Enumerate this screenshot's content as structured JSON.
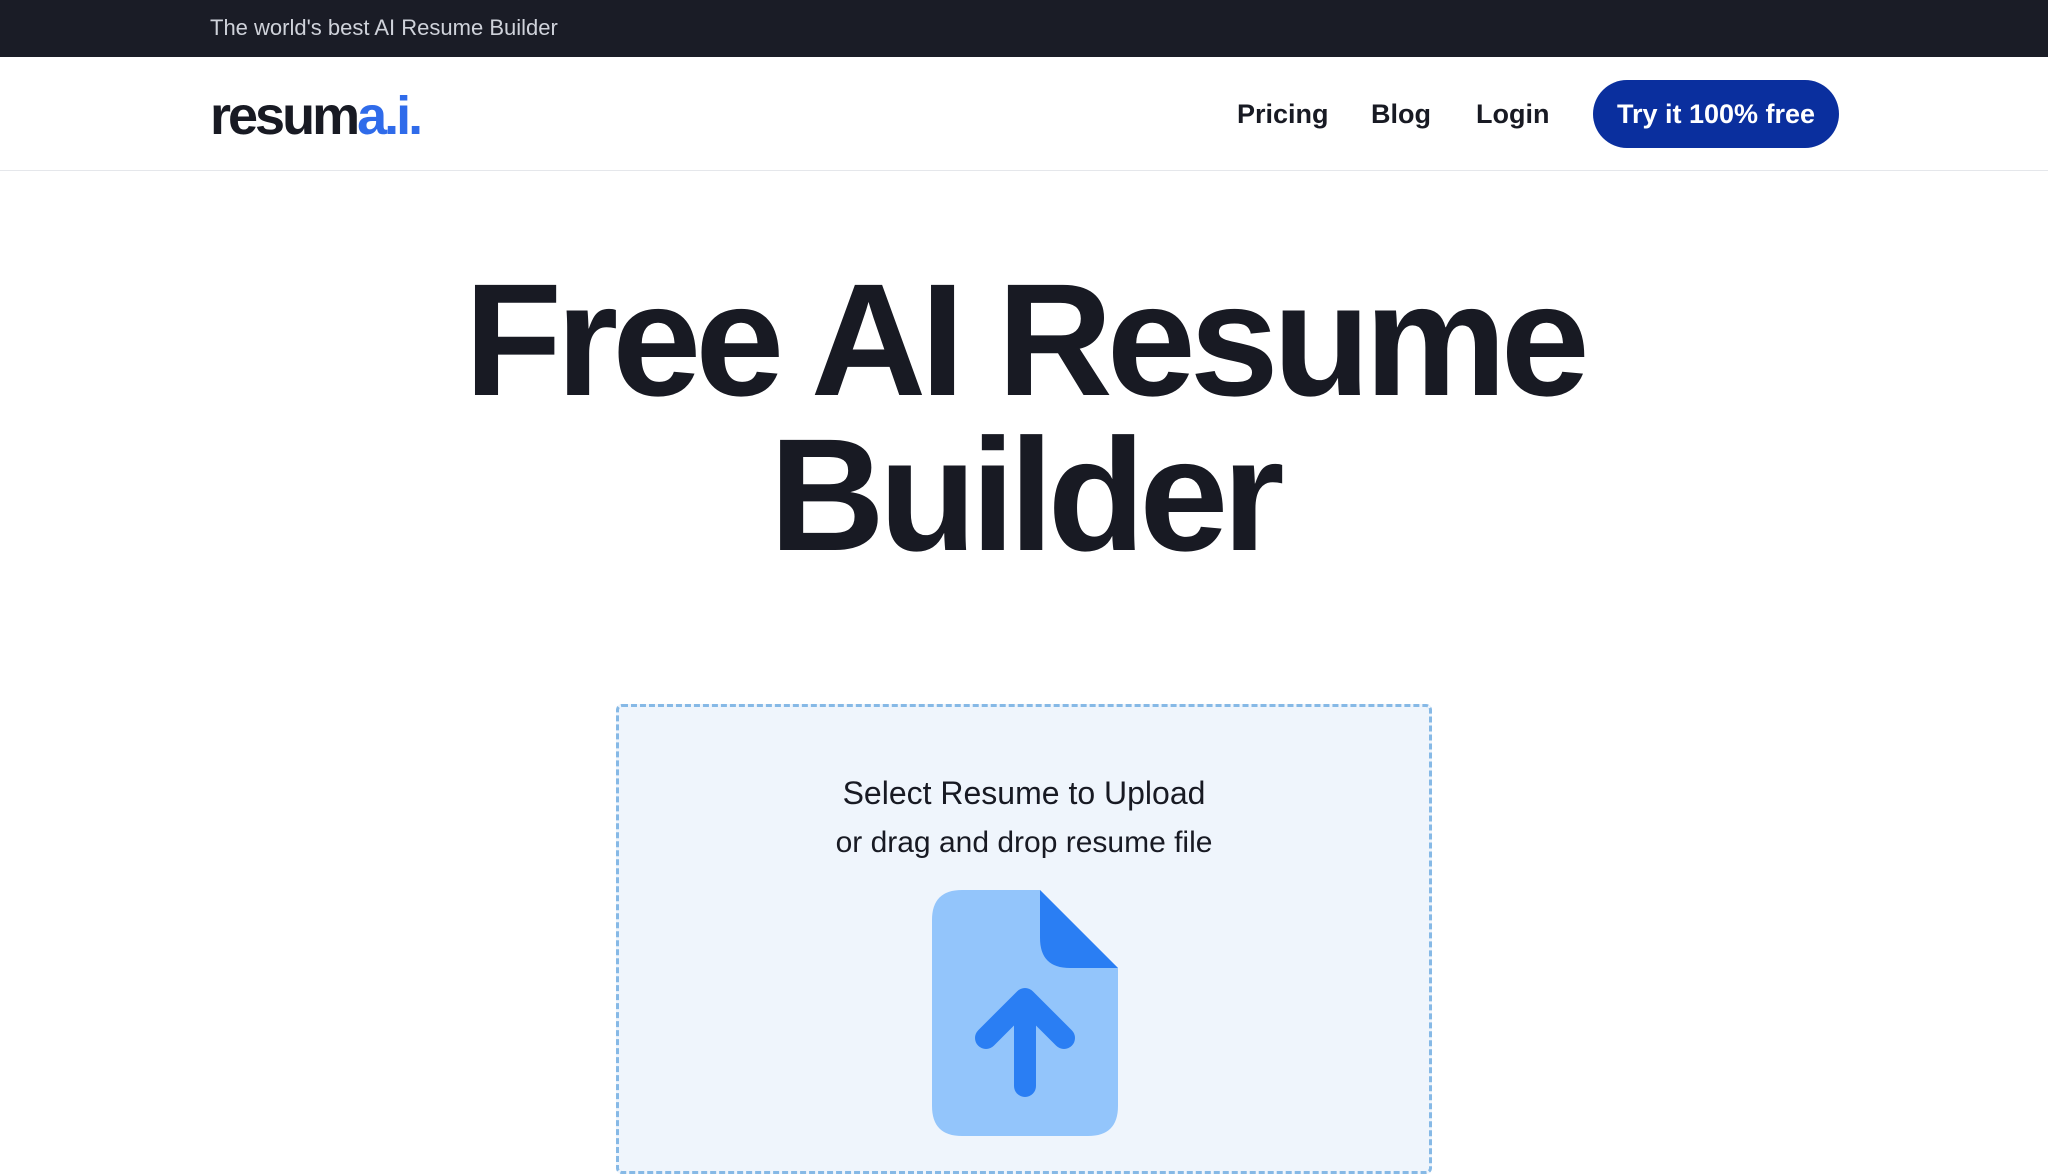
{
  "announcement": {
    "text": "The world's best AI Resume Builder"
  },
  "header": {
    "logo": {
      "main": "resum",
      "accent": "a.i."
    },
    "nav": {
      "pricing": "Pricing",
      "blog": "Blog",
      "login": "Login"
    },
    "cta_label": "Try it 100% free"
  },
  "hero": {
    "title_line1": "Free AI Resume",
    "title_line2": "Builder"
  },
  "upload": {
    "title": "Select Resume to Upload",
    "subtitle": "or drag and drop resume file",
    "icon": "file-upload-icon"
  },
  "colors": {
    "announcement_bg": "#1a1c26",
    "logo_accent": "#2f6bea",
    "cta_bg": "#0a2f9e",
    "dropzone_bg": "#eff5fc",
    "dropzone_border": "#86b9e6",
    "icon_light": "#93c5fb",
    "icon_dark": "#2a7ef3"
  }
}
